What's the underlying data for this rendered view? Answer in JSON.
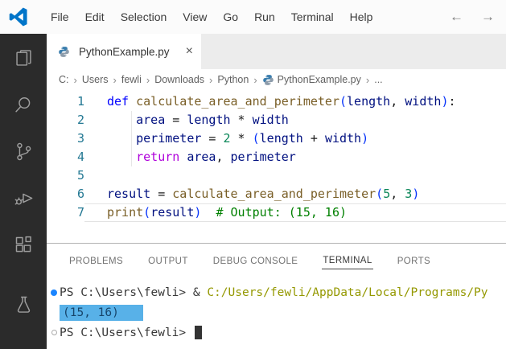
{
  "colors": {
    "accent": "#007acc",
    "activity_bar_bg": "#2b2b2b",
    "tab_strip_bg": "#ececec",
    "keyword": "#0000ff",
    "control_keyword": "#af00db",
    "function": "#795e26",
    "variable": "#001080",
    "number": "#098658",
    "comment": "#008000",
    "bracket": "#0431fa",
    "line_number": "#237893",
    "terminal_path": "#949800",
    "terminal_selection_bg": "#58b1e8",
    "command_decoration": "#1a85ff"
  },
  "title_bar": {
    "menus": [
      "File",
      "Edit",
      "Selection",
      "View",
      "Go",
      "Run",
      "Terminal",
      "Help"
    ],
    "back_glyph": "←",
    "forward_glyph": "→"
  },
  "activity_bar": {
    "items": [
      "explorer",
      "search",
      "source-control",
      "run-debug",
      "extensions",
      "testing"
    ]
  },
  "editor_tab": {
    "label": "PythonExample.py",
    "close_glyph": "×"
  },
  "breadcrumb": {
    "items": [
      "C:",
      "Users",
      "fewli",
      "Downloads",
      "Python",
      "PythonExample.py",
      "..."
    ],
    "separator": "›"
  },
  "editor": {
    "lines": [
      {
        "n": "1",
        "tokens": [
          [
            "def",
            "kw"
          ],
          [
            " ",
            "pl"
          ],
          [
            "calculate_area_and_perimeter",
            "fn"
          ],
          [
            "(",
            "br"
          ],
          [
            "length",
            "var"
          ],
          [
            ", ",
            "pl"
          ],
          [
            "width",
            "var"
          ],
          [
            ")",
            "br"
          ],
          [
            ":",
            "pl"
          ]
        ]
      },
      {
        "n": "2",
        "tokens": [
          [
            "    ",
            "pl"
          ],
          [
            "area",
            "var"
          ],
          [
            " = ",
            "pl"
          ],
          [
            "length",
            "var"
          ],
          [
            " * ",
            "pl"
          ],
          [
            "width",
            "var"
          ]
        ]
      },
      {
        "n": "3",
        "tokens": [
          [
            "    ",
            "pl"
          ],
          [
            "perimeter",
            "var"
          ],
          [
            " = ",
            "pl"
          ],
          [
            "2",
            "num"
          ],
          [
            " * ",
            "pl"
          ],
          [
            "(",
            "br"
          ],
          [
            "length",
            "var"
          ],
          [
            " + ",
            "pl"
          ],
          [
            "width",
            "var"
          ],
          [
            ")",
            "br"
          ]
        ]
      },
      {
        "n": "4",
        "tokens": [
          [
            "    ",
            "pl"
          ],
          [
            "return",
            "ctrl"
          ],
          [
            " ",
            "pl"
          ],
          [
            "area",
            "var"
          ],
          [
            ", ",
            "pl"
          ],
          [
            "perimeter",
            "var"
          ]
        ]
      },
      {
        "n": "5",
        "tokens": []
      },
      {
        "n": "6",
        "tokens": [
          [
            "result",
            "var"
          ],
          [
            " = ",
            "pl"
          ],
          [
            "calculate_area_and_perimeter",
            "fn"
          ],
          [
            "(",
            "br"
          ],
          [
            "5",
            "num"
          ],
          [
            ", ",
            "pl"
          ],
          [
            "3",
            "num"
          ],
          [
            ")",
            "br"
          ]
        ]
      },
      {
        "n": "7",
        "current": true,
        "tokens": [
          [
            "print",
            "fn"
          ],
          [
            "(",
            "br"
          ],
          [
            "result",
            "var"
          ],
          [
            ")",
            "br"
          ],
          [
            "  ",
            "pl"
          ],
          [
            "# Output: (15, 16)",
            "com"
          ]
        ]
      }
    ]
  },
  "panel": {
    "tabs": [
      {
        "label": "PROBLEMS",
        "active": false
      },
      {
        "label": "OUTPUT",
        "active": false
      },
      {
        "label": "DEBUG CONSOLE",
        "active": false
      },
      {
        "label": "TERMINAL",
        "active": true
      },
      {
        "label": "PORTS",
        "active": false
      }
    ]
  },
  "terminal": {
    "rows": [
      {
        "decoration": "filled",
        "segments": [
          [
            "PS C:\\Users\\fewli> & ",
            "fg"
          ],
          [
            "C:/Users/fewli/AppData/Local/Programs/Py",
            "path"
          ]
        ],
        "cursor": false
      },
      {
        "decoration": "none",
        "segments": [
          [
            "(15, 16)",
            "sel"
          ]
        ],
        "cursor": false
      },
      {
        "decoration": "empty",
        "segments": [
          [
            "PS C:\\Users\\fewli> ",
            "fg"
          ]
        ],
        "cursor": true
      }
    ]
  }
}
